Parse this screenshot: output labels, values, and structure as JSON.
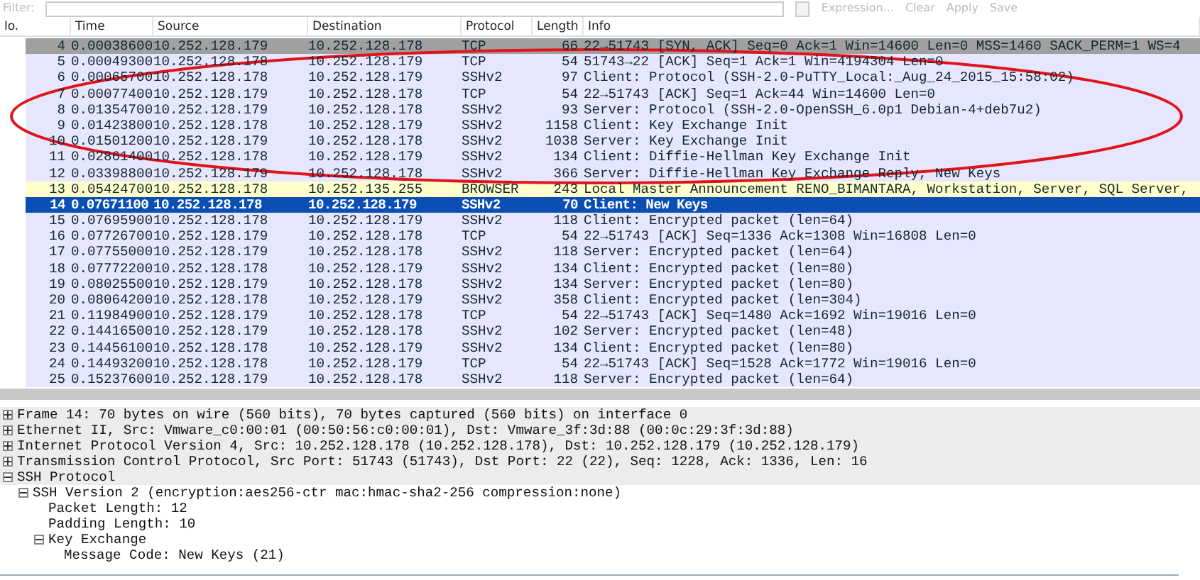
{
  "filter_bar": {
    "label": "Filter:",
    "actions": [
      "Expression...",
      "Clear",
      "Apply",
      "Save"
    ]
  },
  "packet_list": {
    "columns": [
      "lo.",
      "Time",
      "Source",
      "Destination",
      "Protocol",
      "Length",
      "Info"
    ],
    "rows": [
      {
        "cells": [
          "4",
          "0.00038600",
          "10.252.128.179",
          "10.252.128.178",
          "TCP",
          "66",
          "22→51743 [SYN, ACK] Seq=0 Ack=1 Win=14600 Len=0 MSS=1460 SACK_PERM=1 WS=4"
        ],
        "color": "#a0a0a0",
        "selected": false
      },
      {
        "cells": [
          "5",
          "0.00049300",
          "10.252.128.178",
          "10.252.128.179",
          "TCP",
          "54",
          "51743→22 [ACK] Seq=1 Ack=1 Win=4194304 Len=0"
        ],
        "color": "#e7e6ff",
        "selected": false
      },
      {
        "cells": [
          "6",
          "0.00065700",
          "10.252.128.178",
          "10.252.128.179",
          "SSHv2",
          "97",
          "Client: Protocol (SSH-2.0-PuTTY_Local:_Aug_24_2015_15:58:02)"
        ],
        "color": "#e7e6ff",
        "selected": false
      },
      {
        "cells": [
          "7",
          "0.00077400",
          "10.252.128.179",
          "10.252.128.178",
          "TCP",
          "54",
          "22→51743 [ACK] Seq=1 Ack=44 Win=14600 Len=0"
        ],
        "color": "#e7e6ff",
        "selected": false
      },
      {
        "cells": [
          "8",
          "0.01354700",
          "10.252.128.179",
          "10.252.128.178",
          "SSHv2",
          "93",
          "Server: Protocol (SSH-2.0-OpenSSH_6.0p1 Debian-4+deb7u2)"
        ],
        "color": "#e7e6ff",
        "selected": false
      },
      {
        "cells": [
          "9",
          "0.01423800",
          "10.252.128.178",
          "10.252.128.179",
          "SSHv2",
          "1158",
          "Client: Key Exchange Init"
        ],
        "color": "#e7e6ff",
        "selected": false
      },
      {
        "cells": [
          "10",
          "0.01501200",
          "10.252.128.179",
          "10.252.128.178",
          "SSHv2",
          "1038",
          "Server: Key Exchange Init"
        ],
        "color": "#e7e6ff",
        "selected": false
      },
      {
        "cells": [
          "11",
          "0.02861400",
          "10.252.128.178",
          "10.252.128.179",
          "SSHv2",
          "134",
          "Client: Diffie-Hellman Key Exchange Init"
        ],
        "color": "#e7e6ff",
        "selected": false
      },
      {
        "cells": [
          "12",
          "0.03398800",
          "10.252.128.179",
          "10.252.128.178",
          "SSHv2",
          "366",
          "Server: Diffie-Hellman Key Exchange Reply, New Keys"
        ],
        "color": "#e7e6ff",
        "selected": false
      },
      {
        "cells": [
          "13",
          "0.05424700",
          "10.252.128.178",
          "10.252.135.255",
          "BROWSER",
          "243",
          "Local Master Announcement RENO_BIMANTARA, Workstation, Server, SQL Server,"
        ],
        "color": "#ffffcc",
        "selected": false
      },
      {
        "cells": [
          "14",
          "0.07671100",
          "10.252.128.178",
          "10.252.128.179",
          "SSHv2",
          "70",
          "Client: New Keys"
        ],
        "selected": true
      },
      {
        "cells": [
          "15",
          "0.07695900",
          "10.252.128.178",
          "10.252.128.179",
          "SSHv2",
          "118",
          "Client: Encrypted packet (len=64)"
        ],
        "color": "#e7e6ff",
        "selected": false
      },
      {
        "cells": [
          "16",
          "0.07726700",
          "10.252.128.179",
          "10.252.128.178",
          "TCP",
          "54",
          "22→51743 [ACK] Seq=1336 Ack=1308 Win=16808 Len=0"
        ],
        "color": "#e7e6ff",
        "selected": false
      },
      {
        "cells": [
          "17",
          "0.07755000",
          "10.252.128.179",
          "10.252.128.178",
          "SSHv2",
          "118",
          "Server: Encrypted packet (len=64)"
        ],
        "color": "#e7e6ff",
        "selected": false
      },
      {
        "cells": [
          "18",
          "0.07772200",
          "10.252.128.178",
          "10.252.128.179",
          "SSHv2",
          "134",
          "Client: Encrypted packet (len=80)"
        ],
        "color": "#e7e6ff",
        "selected": false
      },
      {
        "cells": [
          "19",
          "0.08025500",
          "10.252.128.179",
          "10.252.128.178",
          "SSHv2",
          "134",
          "Server: Encrypted packet (len=80)"
        ],
        "color": "#e7e6ff",
        "selected": false
      },
      {
        "cells": [
          "20",
          "0.08064200",
          "10.252.128.178",
          "10.252.128.179",
          "SSHv2",
          "358",
          "Client: Encrypted packet (len=304)"
        ],
        "color": "#e7e6ff",
        "selected": false
      },
      {
        "cells": [
          "21",
          "0.11984900",
          "10.252.128.179",
          "10.252.128.178",
          "TCP",
          "54",
          "22→51743 [ACK] Seq=1480 Ack=1692 Win=19016 Len=0"
        ],
        "color": "#e7e6ff",
        "selected": false
      },
      {
        "cells": [
          "22",
          "0.14416500",
          "10.252.128.179",
          "10.252.128.178",
          "SSHv2",
          "102",
          "Server: Encrypted packet (len=48)"
        ],
        "color": "#e7e6ff",
        "selected": false
      },
      {
        "cells": [
          "23",
          "0.14456100",
          "10.252.128.178",
          "10.252.128.179",
          "SSHv2",
          "134",
          "Client: Encrypted packet (len=80)"
        ],
        "color": "#e7e6ff",
        "selected": false
      },
      {
        "cells": [
          "24",
          "0.14493200",
          "10.252.128.178",
          "10.252.128.179",
          "TCP",
          "54",
          "22→51743 [ACK] Seq=1528 Ack=1772 Win=19016 Len=0"
        ],
        "color": "#e7e6ff",
        "selected": false
      },
      {
        "cells": [
          "25",
          "0.15237600",
          "10.252.128.179",
          "10.252.128.178",
          "SSHv2",
          "118",
          "Server: Encrypted packet (len=64)"
        ],
        "color": "#e7e6ff",
        "selected": false
      }
    ]
  },
  "packet_details": [
    {
      "text": "Frame 14: 70 bytes on wire (560 bits), 70 bytes captured (560 bits) on interface 0",
      "expanded": false
    },
    {
      "text": "Ethernet II, Src: Vmware_c0:00:01 (00:50:56:c0:00:01), Dst: Vmware_3f:3d:88 (00:0c:29:3f:3d:88)",
      "expanded": false
    },
    {
      "text": "Internet Protocol Version 4, Src: 10.252.128.178 (10.252.128.178), Dst: 10.252.128.179 (10.252.128.179)",
      "expanded": false
    },
    {
      "text": "Transmission Control Protocol, Src Port: 51743 (51743), Dst Port: 22 (22), Seq: 1228, Ack: 1336, Len: 16",
      "expanded": false
    },
    {
      "text": "SSH Protocol",
      "expanded": true,
      "children": [
        {
          "text": "SSH Version 2 (encryption:aes256-ctr mac:hmac-sha2-256 compression:none)",
          "expanded": true,
          "children": [
            {
              "text": "Packet Length: 12"
            },
            {
              "text": "Padding Length: 10"
            },
            {
              "text": "Key Exchange",
              "expanded": true,
              "children": [
                {
                  "text": "Message Code: New Keys (21)"
                }
              ]
            }
          ]
        }
      ]
    }
  ]
}
